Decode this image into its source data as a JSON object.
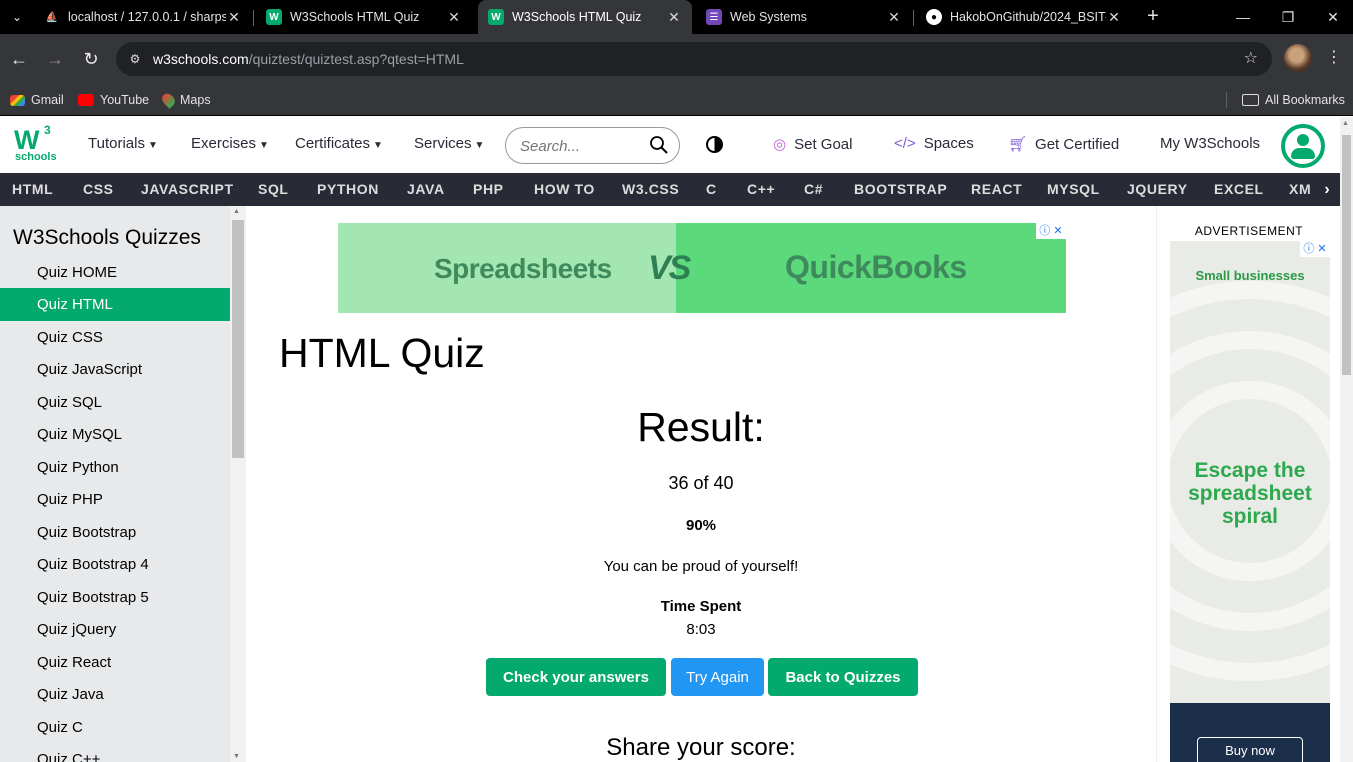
{
  "browser": {
    "tabs": [
      {
        "title": "localhost / 127.0.0.1 / sharps",
        "icon": "phpmyadmin-icon",
        "active": false
      },
      {
        "title": "W3Schools HTML Quiz",
        "icon": "w3schools-icon",
        "active": false
      },
      {
        "title": "W3Schools HTML Quiz",
        "icon": "w3schools-icon",
        "active": true
      },
      {
        "title": "Web Systems",
        "icon": "forms-icon",
        "active": false
      },
      {
        "title": "HakobOnGithub/2024_BSIT-",
        "icon": "github-icon",
        "active": false
      }
    ],
    "url_host": "w3schools.com",
    "url_path": "/quiztest/quiztest.asp?qtest=HTML",
    "bookmarks": [
      "Gmail",
      "YouTube",
      "Maps"
    ],
    "all_bookmarks": "All Bookmarks"
  },
  "w3nav": {
    "logo_text": "W",
    "logo_sup": "3",
    "logo_sub": "schools",
    "tutorials": "Tutorials",
    "exercises": "Exercises",
    "certificates": "Certificates",
    "services": "Services",
    "search_placeholder": "Search...",
    "set_goal": "Set Goal",
    "spaces": "Spaces",
    "get_certified": "Get Certified",
    "my_w3schools": "My W3Schools"
  },
  "subjects": [
    "HTML",
    "CSS",
    "JAVASCRIPT",
    "SQL",
    "PYTHON",
    "JAVA",
    "PHP",
    "HOW TO",
    "W3.CSS",
    "C",
    "C++",
    "C#",
    "BOOTSTRAP",
    "REACT",
    "MYSQL",
    "JQUERY",
    "EXCEL",
    "XM"
  ],
  "sidebar": {
    "title": "W3Schools Quizzes",
    "items": [
      "Quiz HOME",
      "Quiz HTML",
      "Quiz CSS",
      "Quiz JavaScript",
      "Quiz SQL",
      "Quiz MySQL",
      "Quiz Python",
      "Quiz PHP",
      "Quiz Bootstrap",
      "Quiz Bootstrap 4",
      "Quiz Bootstrap 5",
      "Quiz jQuery",
      "Quiz React",
      "Quiz Java",
      "Quiz C",
      "Quiz C++"
    ],
    "active_index": 1
  },
  "banner_ad": {
    "left_text": "Spreadsheets",
    "vs_text": "VS",
    "right_text": "QuickBooks"
  },
  "quiz": {
    "page_title": "HTML Quiz",
    "result_heading": "Result:",
    "score": "36 of 40",
    "percent": "90%",
    "message": "You can be proud of yourself!",
    "time_label": "Time Spent",
    "time_value": "8:03",
    "buttons": {
      "check": "Check your answers",
      "try_again": "Try Again",
      "back": "Back to Quizzes"
    },
    "share_heading": "Share your score:"
  },
  "right_ad": {
    "label": "ADVERTISEMENT",
    "line1": "Small businesses",
    "line2": "Escape the spreadsheet spiral",
    "cta": "Buy now"
  },
  "colors": {
    "w3_green": "#04aa6d",
    "dark_bar": "#282a35",
    "blue_button": "#2196f3",
    "sidebar_bg": "#e7e9eb"
  }
}
